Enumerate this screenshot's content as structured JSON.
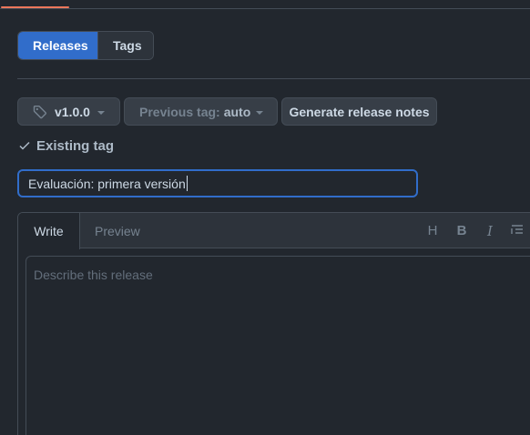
{
  "tabs": {
    "releases_label": "Releases",
    "tags_label": "Tags"
  },
  "controls": {
    "tag_button_label": "v1.0.0",
    "previous_tag_prefix": "Previous tag:",
    "previous_tag_value": "auto",
    "generate_notes_label": "Generate release notes"
  },
  "status": {
    "existing_tag_label": "Existing tag"
  },
  "release_title": {
    "value": "Evaluación: primera versión"
  },
  "editor": {
    "write_tab": "Write",
    "preview_tab": "Preview",
    "toolbar": {
      "heading": "H",
      "bold": "B",
      "italic": "I"
    },
    "body_placeholder": "Describe this release"
  },
  "colors": {
    "background": "#22272e",
    "accent_blue": "#316dca",
    "orange_indicator": "#ec775c"
  }
}
